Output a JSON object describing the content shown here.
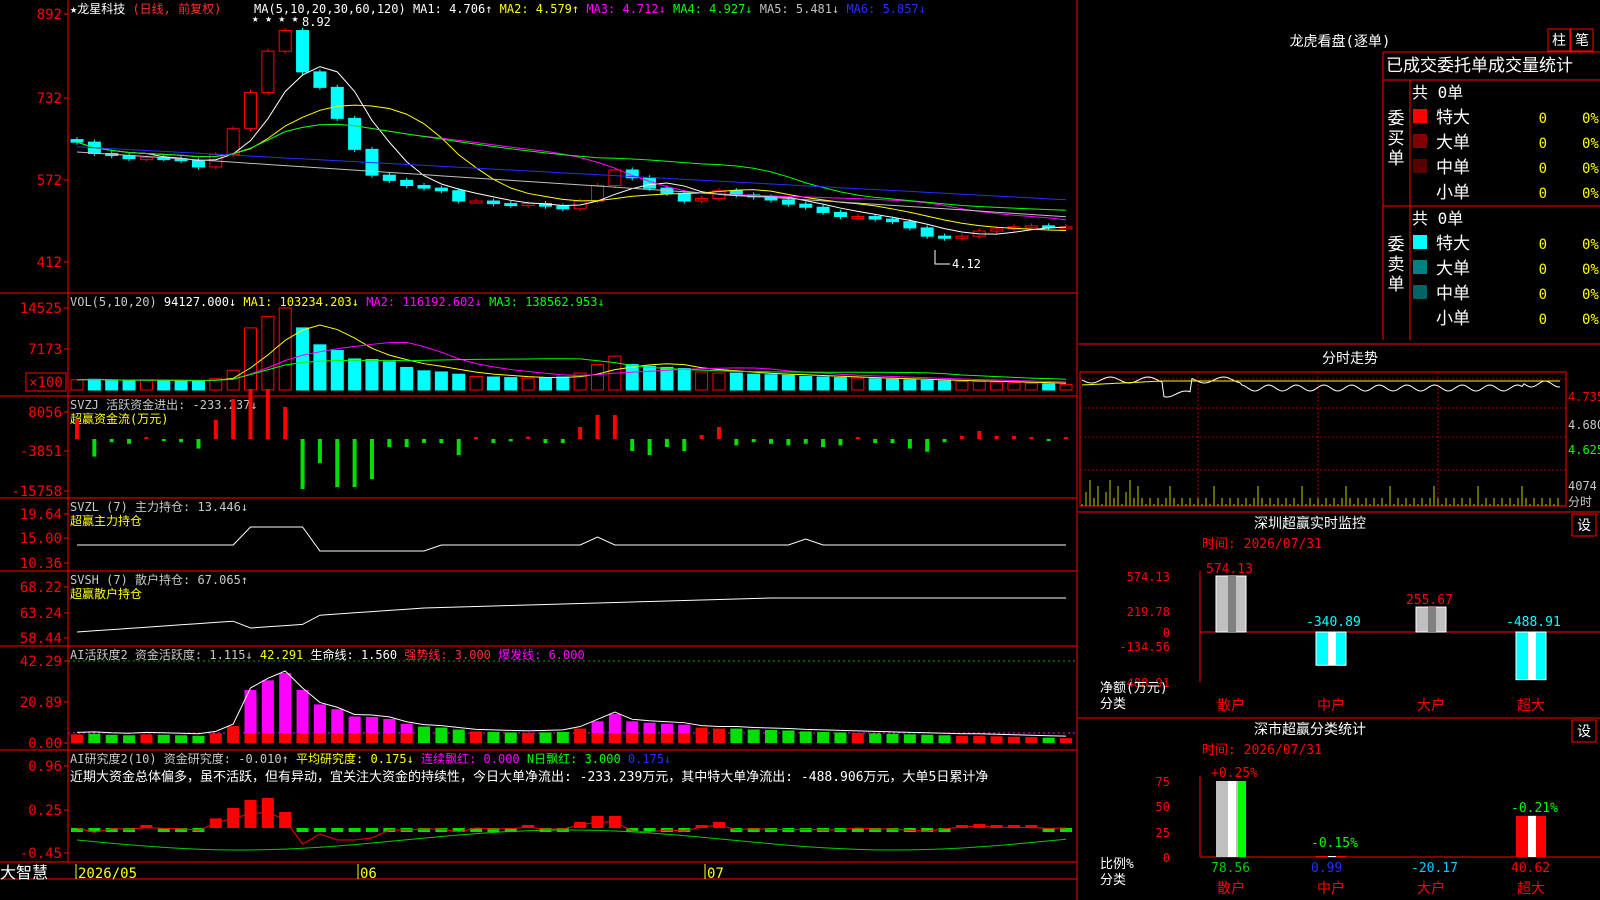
{
  "stock": {
    "name": "★龙星科技",
    "period": "(日线, 前复权)"
  },
  "panels": {
    "price": {
      "y_ticks": [
        "892",
        "732",
        "572",
        "412"
      ],
      "ma_label": "MA(5,10,20,30,60,120)",
      "ma": [
        {
          "text": "MA1: 4.706↑",
          "color": "#ffffff"
        },
        {
          "text": "MA2: 4.579↑",
          "color": "#ffff00"
        },
        {
          "text": "MA3: 4.712↓",
          "color": "#ff00ff"
        },
        {
          "text": "MA4: 4.927↓",
          "color": "#00ff00"
        },
        {
          "text": "MA5: 5.481↓",
          "color": "#c0c0c0"
        },
        {
          "text": "MA6: 5.857↓",
          "color": "#2030ff"
        }
      ],
      "high_label": "8.92",
      "low_label": "4.12"
    },
    "vol": {
      "y_ticks": [
        "14525",
        "7173",
        "×100"
      ],
      "label": "VOL(5,10,20)",
      "value": "94127.000↓",
      "ma": [
        {
          "text": "MA1: 103234.203↓",
          "color": "#ffff00"
        },
        {
          "text": "MA2: 116192.602↓",
          "color": "#ff00ff"
        },
        {
          "text": "MA3: 138562.953↓",
          "color": "#00ff00"
        }
      ]
    },
    "svzj": {
      "y_ticks": [
        "8056",
        "-3851",
        "-15758"
      ],
      "label": "SVZJ  活跃资金进出: -233.237↓",
      "subtitle": "超赢资金流(万元)"
    },
    "svzl": {
      "y_ticks": [
        "19.64",
        "15.00",
        "10.36"
      ],
      "label": "SVZL (7) 主力持仓: 13.446↓",
      "subtitle": "超赢主力持仓"
    },
    "svsh": {
      "y_ticks": [
        "68.22",
        "63.24",
        "58.44"
      ],
      "label": "SVSH (7) 散户持仓: 67.065↑",
      "subtitle": "超赢散户持仓"
    },
    "ai1": {
      "y_ticks": [
        "42.29",
        "20.89",
        "0.00"
      ],
      "label": "AI活跃度2 资金活跃度: 1.115↓",
      "extra": [
        {
          "text": "42.291",
          "color": "#ffff00"
        },
        {
          "text": "生命线: 1.560",
          "color": "#ffffff"
        },
        {
          "text": "强势线: 3.000",
          "color": "#ff3030"
        },
        {
          "text": "爆发线: 6.000",
          "color": "#ff00ff"
        }
      ]
    },
    "ai2": {
      "y_ticks": [
        "0.96",
        "0.25",
        "-0.45"
      ],
      "label": "AI研究度2(10) 资金研究度: -0.010↑",
      "extra": [
        {
          "text": "平均研究度: 0.175↓",
          "color": "#ffff00"
        },
        {
          "text": "连续飘红: 0.000",
          "color": "#ff00ff"
        },
        {
          "text": "N日飘红: 3.000",
          "color": "#00ff00"
        },
        {
          "text": "0.175↓",
          "color": "#2030ff"
        }
      ],
      "note": "近期大资金总体偏多，虽不活跃，但有异动，宜关注大资金的持续性，今日大单净流出: -233.239万元，其中特大单净流出: -488.906万元，大单5日累计净"
    }
  },
  "x_axis": {
    "labels": [
      "2026/05",
      "06",
      "07"
    ]
  },
  "brand": "大智慧",
  "right_panel": {
    "dragon": {
      "title": "龙虎看盘(逐单)",
      "tab1": "柱",
      "tab2": "笔",
      "header": "已成交委托单成交量统计",
      "buy": {
        "side": "委买单",
        "total": "共 0单",
        "rows": [
          {
            "label": "特大",
            "count": "0",
            "pct": "0%",
            "color": "#ff0000"
          },
          {
            "label": "大单",
            "count": "0",
            "pct": "0%",
            "color": "#800000"
          },
          {
            "label": "中单",
            "count": "0",
            "pct": "0%",
            "color": "#5a0000"
          },
          {
            "label": "小单",
            "count": "0",
            "pct": "0%",
            "color": ""
          }
        ]
      },
      "sell": {
        "side": "委卖单",
        "total": "共 0单",
        "rows": [
          {
            "label": "特大",
            "count": "0",
            "pct": "0%",
            "color": "#00ffff"
          },
          {
            "label": "大单",
            "count": "0",
            "pct": "0%",
            "color": "#008080"
          },
          {
            "label": "中单",
            "count": "0",
            "pct": "0%",
            "color": "#006464"
          },
          {
            "label": "小单",
            "count": "0",
            "pct": "0%",
            "color": ""
          }
        ]
      }
    },
    "intraday": {
      "title": "分时走势",
      "y_ticks": [
        "4.735",
        "4.680",
        "4.625"
      ],
      "vol_tick": "4074",
      "vol_label": "分时"
    },
    "szmonitor": {
      "title": "深圳超赢实时监控",
      "set": "设",
      "time": "时间: 2026/07/31",
      "y_ticks": [
        "574.13",
        "219.78",
        "0",
        "-134.56",
        "-488.91"
      ],
      "y_unit": "净额(万元)",
      "x_unit": "分类",
      "bars": [
        {
          "cat": "散户",
          "value": 574.13,
          "label": "574.13"
        },
        {
          "cat": "中户",
          "value": -340.89,
          "label": "-340.89"
        },
        {
          "cat": "大户",
          "value": 255.67,
          "label": "255.67"
        },
        {
          "cat": "超大",
          "value": -488.91,
          "label": "-488.91"
        }
      ]
    },
    "szstats": {
      "title": "深市超赢分类统计",
      "set": "设",
      "time": "时间: 2026/07/31",
      "y_ticks": [
        "75",
        "50",
        "25",
        "0"
      ],
      "y_unit": "比例%",
      "x_unit": "分类",
      "bars": [
        {
          "cat": "散户",
          "value": 78.56,
          "pct": "+0.25%"
        },
        {
          "cat": "中户",
          "value": 0.99,
          "pct": "-0.15%"
        },
        {
          "cat": "大户",
          "value": -20.17,
          "pct": ""
        },
        {
          "cat": "超大",
          "value": 40.62,
          "pct": "-0.21%"
        }
      ]
    }
  },
  "chart_data": [
    {
      "type": "candlestick",
      "title": "★龙星科技 (日线, 前复权)",
      "x": [
        "2026/05",
        "06",
        "07"
      ],
      "ylim": [
        4.12,
        8.92
      ],
      "approx_close": [
        6.44,
        6.22,
        6.18,
        6.12,
        6.14,
        6.12,
        6.08,
        5.96,
        6.2,
        6.7,
        7.4,
        8.2,
        8.6,
        7.8,
        7.5,
        6.9,
        6.3,
        5.8,
        5.7,
        5.6,
        5.55,
        5.5,
        5.3,
        5.3,
        5.25,
        5.22,
        5.25,
        5.2,
        5.15,
        5.3,
        5.6,
        5.9,
        5.75,
        5.55,
        5.45,
        5.3,
        5.35,
        5.5,
        5.42,
        5.38,
        5.32,
        5.24,
        5.18,
        5.08,
        5.0,
        5.0,
        4.95,
        4.9,
        4.78,
        4.62,
        4.58,
        4.62,
        4.72,
        4.76,
        4.8,
        4.82,
        4.8,
        4.8
      ],
      "high": 8.92,
      "low": 4.12
    },
    {
      "type": "bar",
      "title": "VOL(5,10,20)",
      "values_hundreds": [
        1800,
        1900,
        1700,
        1600,
        1800,
        1700,
        1600,
        1500,
        2000,
        3500,
        11000,
        13000,
        14525,
        11000,
        8000,
        7000,
        5500,
        5400,
        5000,
        4000,
        3400,
        3200,
        2800,
        2400,
        2300,
        2200,
        2100,
        2200,
        2300,
        3000,
        4500,
        6000,
        4500,
        4200,
        4000,
        3800,
        3200,
        3000,
        3000,
        2800,
        2700,
        2600,
        2400,
        2300,
        2200,
        2100,
        2000,
        1900,
        1800,
        1700,
        1600,
        1500,
        1500,
        1400,
        1300,
        1200,
        1100,
        1000
      ],
      "ylim": [
        0,
        14525
      ]
    },
    {
      "type": "bar",
      "title": "SVZJ 活跃资金进出",
      "last": -233.237,
      "ylim": [
        -15758,
        8056
      ]
    },
    {
      "type": "line",
      "title": "SVZL (7) 主力持仓",
      "last": 13.446,
      "ylim": [
        10.36,
        19.64
      ]
    },
    {
      "type": "line",
      "title": "SVSH (7) 散户持仓",
      "last": 67.065,
      "ylim": [
        58.44,
        68.22
      ]
    },
    {
      "type": "bar",
      "title": "AI活跃度2 资金活跃度",
      "last": 1.115,
      "ylim": [
        0.0,
        42.29
      ]
    },
    {
      "type": "bar",
      "title": "AI研究度2(10) 资金研究度",
      "last": -0.01,
      "ylim": [
        -0.45,
        0.96
      ]
    },
    {
      "type": "bar",
      "title": "深圳超赢实时监控",
      "categories": [
        "散户",
        "中户",
        "大户",
        "超大"
      ],
      "values": [
        574.13,
        -340.89,
        255.67,
        -488.91
      ],
      "ylabel": "净额(万元)",
      "xlabel": "分类"
    },
    {
      "type": "bar",
      "title": "深市超赢分类统计",
      "categories": [
        "散户",
        "中户",
        "大户",
        "超大"
      ],
      "values": [
        78.56,
        0.99,
        -20.17,
        40.62
      ],
      "ylabel": "比例%",
      "xlabel": "分类"
    }
  ]
}
